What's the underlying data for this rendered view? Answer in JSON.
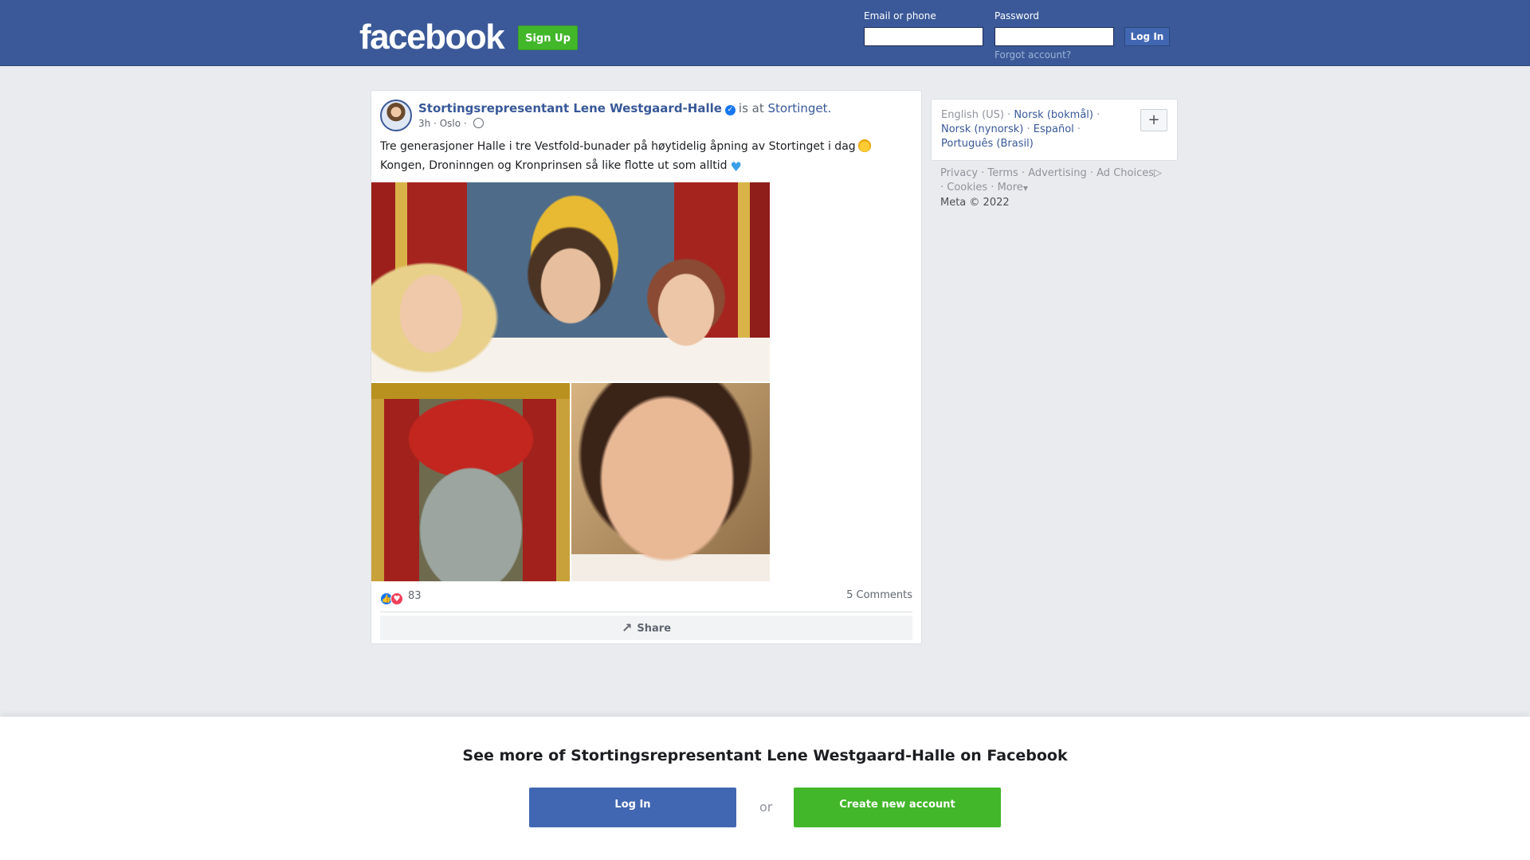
{
  "header": {
    "logo": "facebook",
    "signup_label": "Sign Up",
    "email_label": "Email or phone",
    "password_label": "Password",
    "login_label": "Log In",
    "forgot_label": "Forgot account?"
  },
  "post": {
    "author": "Stortingsrepresentant Lene Westgaard-Halle",
    "is_at": "is at",
    "place": "Stortinget.",
    "time": "3h",
    "location": "Oslo",
    "line1": "Tre generasjoner Halle i tre Vestfold-bunader på høytidelig åpning av Stortinget i dag",
    "line2": "Kongen, Droninngen og Kronprinsen så like flotte ut som alltid",
    "reaction_count": "83",
    "comments": "5 Comments",
    "share_label": "Share"
  },
  "sidebar": {
    "lang_current": "English (US)",
    "langs": [
      "Norsk (bokmål)",
      "Norsk (nynorsk)",
      "Español",
      "Português (Brasil)"
    ],
    "plus": "+",
    "links": [
      "Privacy",
      "Terms",
      "Advertising",
      "Ad Choices",
      "Cookies",
      "More"
    ],
    "copyright": "Meta © 2022"
  },
  "bottom": {
    "title": "See more of Stortingsrepresentant Lene Westgaard-Halle on Facebook",
    "login_label": "Log In",
    "or": "or",
    "create_label": "Create new account"
  },
  "colors": {
    "brand_blue": "#3b5998",
    "signup_green": "#42b72a",
    "link_blue": "#385898"
  }
}
